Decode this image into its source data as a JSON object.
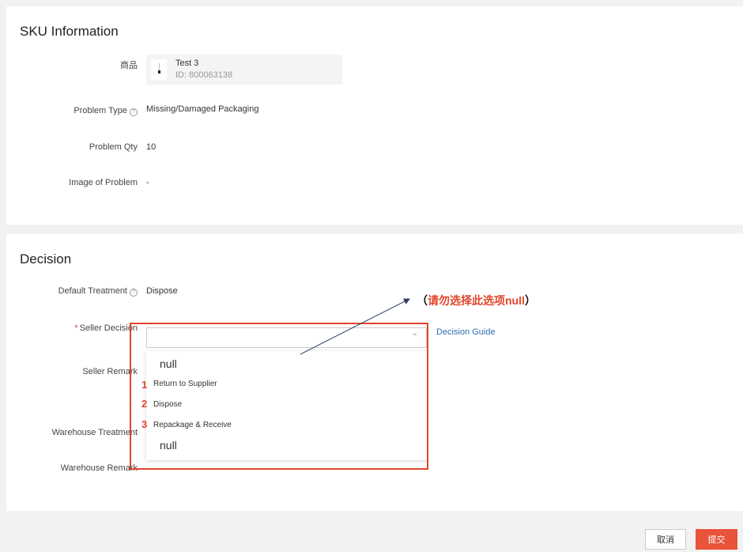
{
  "sku_section": {
    "title": "SKU Information",
    "product_label": "商品",
    "product_name": "Test 3",
    "product_id": "ID: 800063138",
    "problem_type_label": "Problem Type",
    "problem_type_value": "Missing/Damaged Packaging",
    "problem_qty_label": "Problem Qty",
    "problem_qty_value": "10",
    "image_label": "Image of Problem",
    "image_value": "-"
  },
  "decision_section": {
    "title": "Decision",
    "default_treatment_label": "Default Treatment",
    "default_treatment_value": "Dispose",
    "seller_decision_required": "*",
    "seller_decision_label": "Seller Decision",
    "seller_decision_placeholder": "",
    "decision_guide_link": "Decision Guide",
    "seller_remark_label": "Seller Remark",
    "warehouse_treatment_label": "Warehouse Treatment",
    "warehouse_remark_label": "Warehouse Remark",
    "dropdown_options": [
      "null",
      "Return to Supplier",
      "Dispose",
      "Repackage & Receive",
      "null"
    ]
  },
  "annotation": {
    "numbers": [
      "1",
      "2",
      "3"
    ],
    "open_paren": "（",
    "note": "请勿选择此选项null",
    "close_paren": "）",
    "color": "#e2452b"
  },
  "footer": {
    "cancel_label": "取消",
    "submit_label": "提交",
    "submit_color": "#e8533a"
  },
  "icons": {
    "help": "question-circle-icon",
    "chevron": "chevron-up-icon"
  }
}
